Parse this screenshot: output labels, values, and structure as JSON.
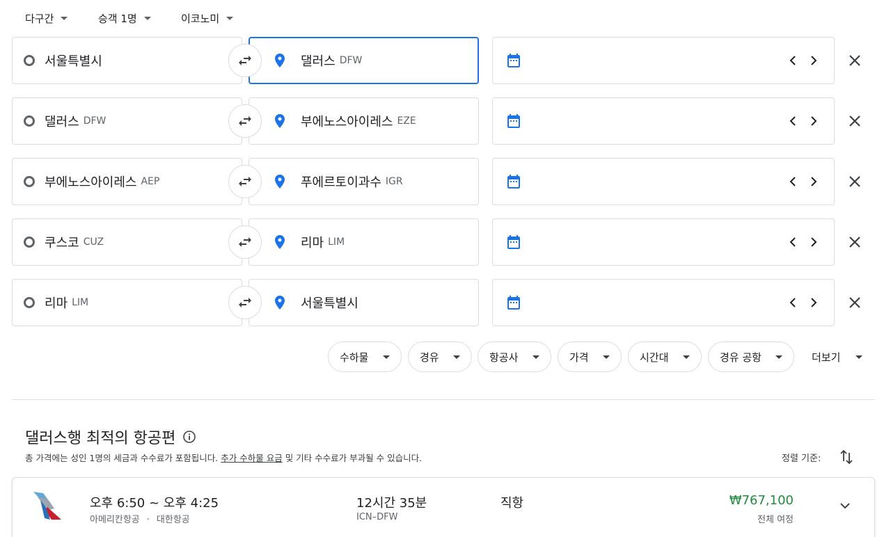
{
  "top_options": {
    "trip_type": "다구간",
    "passengers": "승객 1명",
    "cabin": "이코노미"
  },
  "legs": [
    {
      "from_city": "서울특별시",
      "from_code": "",
      "to_city": "댈러스",
      "to_code": "DFW"
    },
    {
      "from_city": "댈러스",
      "from_code": "DFW",
      "to_city": "부에노스아이레스",
      "to_code": "EZE"
    },
    {
      "from_city": "부에노스아이레스",
      "from_code": "AEP",
      "to_city": "푸에르토이과수",
      "to_code": "IGR"
    },
    {
      "from_city": "쿠스코",
      "from_code": "CUZ",
      "to_city": "리마",
      "to_code": "LIM"
    },
    {
      "from_city": "리마",
      "from_code": "LIM",
      "to_city": "서울특별시",
      "to_code": ""
    }
  ],
  "filters": {
    "chips": [
      "수하물",
      "경유",
      "항공사",
      "가격",
      "시간대",
      "경유 공항"
    ],
    "more": "더보기"
  },
  "results": {
    "title": "댈러스행 최적의 항공편",
    "subtext_before": "총 가격에는 성인 1명의 세금과 수수료가 포함됩니다.",
    "subtext_link": "추가 수하물 요금",
    "subtext_after": "및 기타 수수료가 부과될 수 있습니다.",
    "sort_label": "정렬 기준:"
  },
  "flight": {
    "times": "오후 6:50 ~ 오후 4:25",
    "airline_1": "아메리칸항공",
    "separator": "·",
    "airline_2": "대한항공",
    "duration": "12시간 35분",
    "route": "ICN–DFW",
    "stops": "직항",
    "price": "₩767,100",
    "price_note": "전체 여정"
  },
  "colors": {
    "accent": "#1a73e8",
    "price_green": "#1e8e3e",
    "border": "#dadce0",
    "text": "#202124",
    "secondary_text": "#5f6368"
  },
  "icons": {
    "origin": "hollow-circle-icon",
    "destination": "location-pin-icon",
    "swap": "swap-arrows-icon",
    "calendar": "calendar-icon",
    "prev": "chevron-left-icon",
    "next": "chevron-right-icon",
    "remove": "close-icon",
    "info": "info-icon",
    "sort": "sort-icon",
    "expand": "chevron-down-icon"
  }
}
